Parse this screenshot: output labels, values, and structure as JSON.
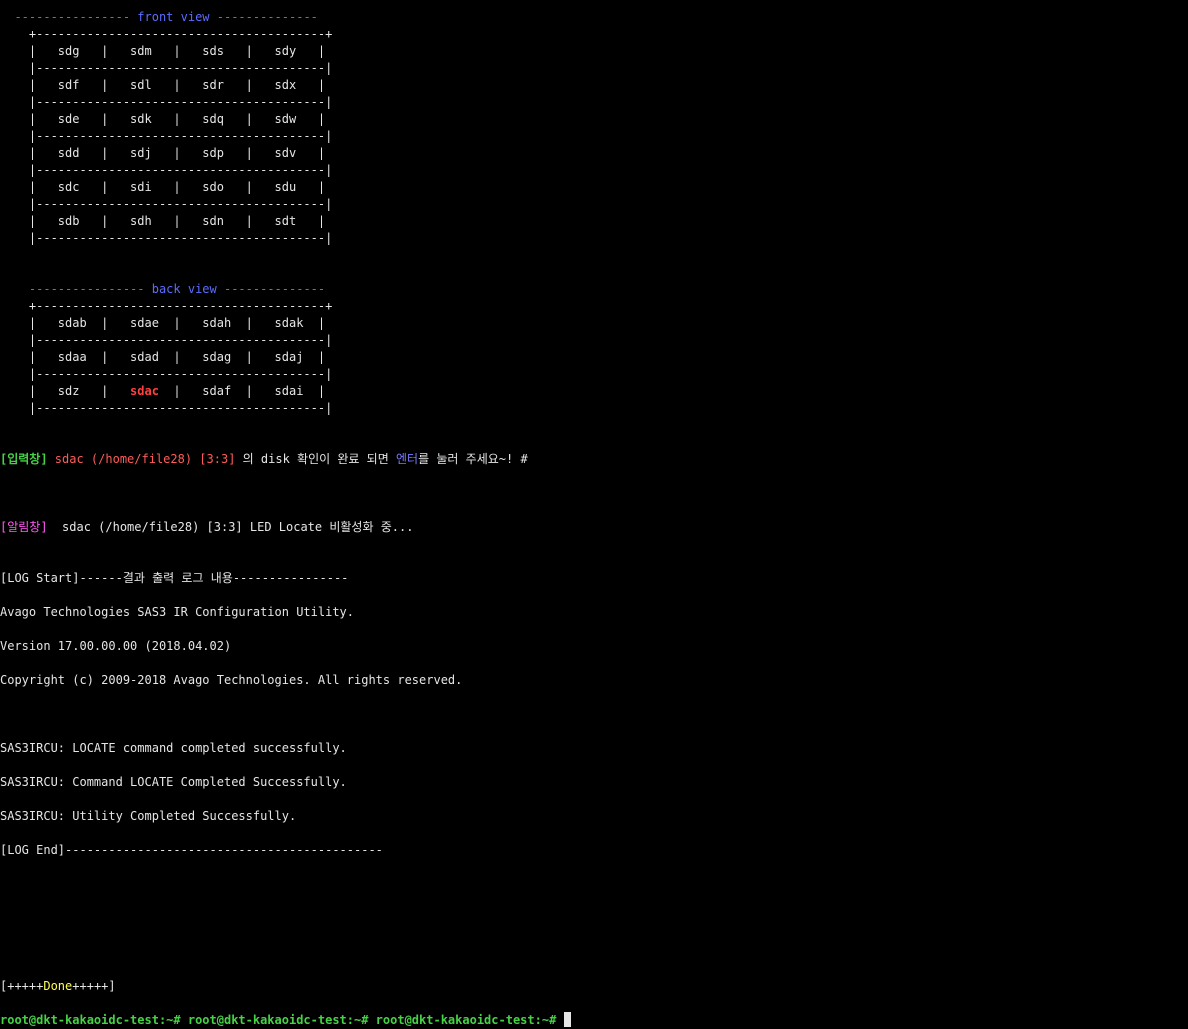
{
  "front": {
    "header_left": "  ----------------",
    "header_title": " front view ",
    "header_right": "--------------",
    "border_top": "    +----------------------------------------+",
    "rows": [
      "    |   sdg   |   sdm   |   sds   |   sdy   |",
      "    |   sdf   |   sdl   |   sdr   |   sdx   |",
      "    |   sde   |   sdk   |   sdq   |   sdw   |",
      "    |   sdd   |   sdj   |   sdp   |   sdv   |",
      "    |   sdc   |   sdi   |   sdo   |   sdu   |",
      "    |   sdb   |   sdh   |   sdn   |   sdt   |"
    ],
    "separator": "    |----------------------------------------|"
  },
  "back": {
    "header_left": "    ----------------",
    "header_title": " back view ",
    "header_right": "--------------",
    "border_top": "    +----------------------------------------+",
    "rows": [
      "    |   sdab  |   sdae  |   sdah  |   sdak  |",
      "    |   sdaa  |   sdad  |   sdag  |   sdaj  |"
    ],
    "last_row_prefix": "    |   sdz   |   ",
    "last_row_highlight": "sdac",
    "last_row_suffix": "  |   sdaf  |   sdai  |",
    "separator": "    |----------------------------------------|"
  },
  "input_prompt": {
    "tag": "[입력창]",
    "disk": " sdac (/home/file28) [3:3]",
    "middle": " 의 disk 확인이 완료 되면 ",
    "enter": "엔터",
    "rest": "를 눌러 주세요~! #"
  },
  "alert": {
    "tag": "[알림창]",
    "message": "  sdac (/home/file28) [3:3] LED Locate 비활성화 중..."
  },
  "log": {
    "start": "[LOG Start]------결과 출력 로그 내용----------------",
    "line1": "Avago Technologies SAS3 IR Configuration Utility.",
    "line2": "Version 17.00.00.00 (2018.04.02)",
    "line3": "Copyright (c) 2009-2018 Avago Technologies. All rights reserved.",
    "line4": "SAS3IRCU: LOCATE command completed successfully.",
    "line5": "SAS3IRCU: Command LOCATE Completed Successfully.",
    "line6": "SAS3IRCU: Utility Completed Successfully.",
    "end": "[LOG End]--------------------------------------------"
  },
  "done": {
    "left": "[+++++",
    "word": "Done",
    "right": "+++++]"
  },
  "prompt": {
    "text": "root@dkt-kakaoidc-test:~# root@dkt-kakaoidc-test:~# root@dkt-kakaoidc-test:~# "
  },
  "colors": {
    "background": "#000000",
    "foreground": "#e6e6e6",
    "header_blue": "#5c6cff",
    "green": "#45d245",
    "red": "#ff4040",
    "magenta": "#ff5cf2",
    "yellow": "#ffff55"
  }
}
